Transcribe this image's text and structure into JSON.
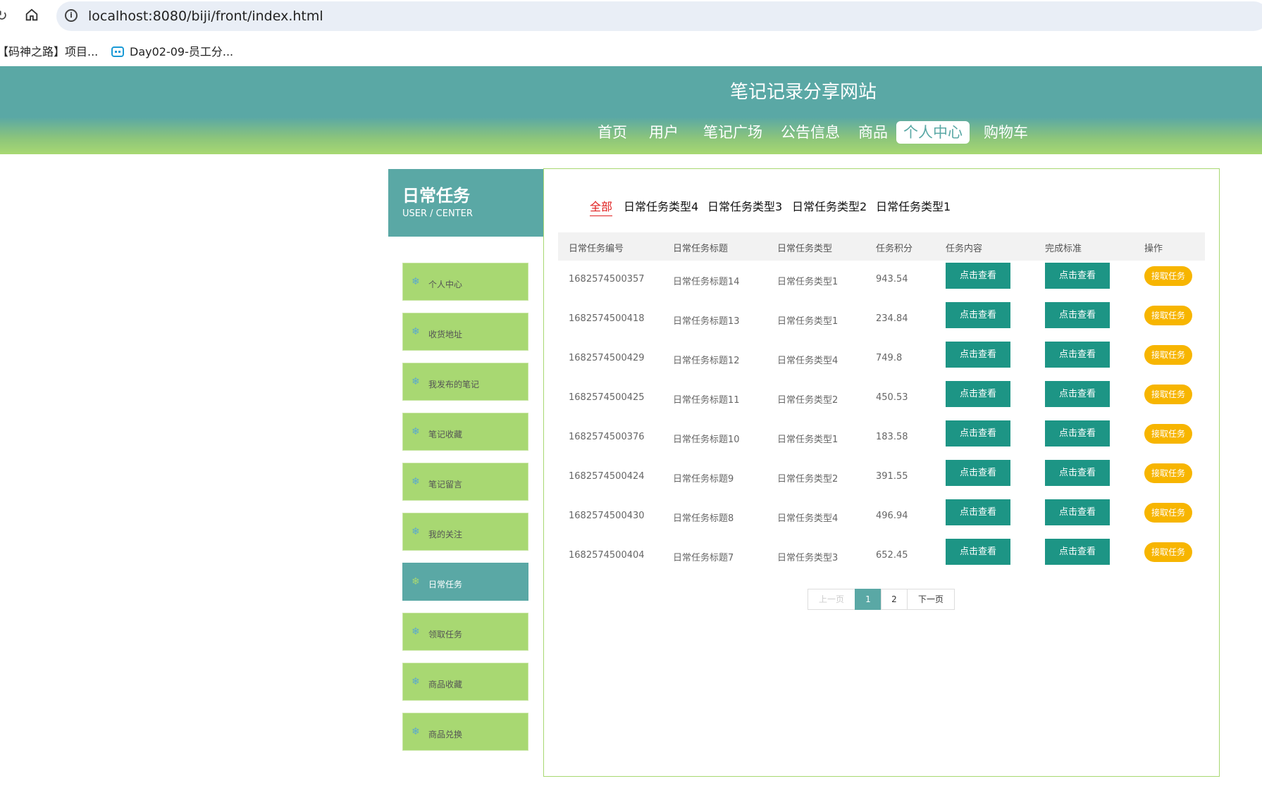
{
  "browser": {
    "url": "localhost:8080/biji/front/index.html",
    "bookmarks": [
      "【码神之路】项目...",
      "Day02-09-员工分..."
    ]
  },
  "site": {
    "title": "笔记记录分享网站",
    "nav": [
      "首页",
      "用户",
      "笔记广场",
      "公告信息",
      "商品",
      "个人中心",
      "购物车"
    ],
    "nav_active": "个人中心"
  },
  "sidebar": {
    "title": "日常任务",
    "subtitle": "USER / CENTER",
    "items": [
      "个人中心",
      "收货地址",
      "我发布的笔记",
      "笔记收藏",
      "笔记留言",
      "我的关注",
      "日常任务",
      "领取任务",
      "商品收藏",
      "商品兑换"
    ],
    "active": "日常任务"
  },
  "filters": [
    "全部",
    "日常任务类型4",
    "日常任务类型3",
    "日常任务类型2",
    "日常任务类型1"
  ],
  "table": {
    "headers": [
      "日常任务编号",
      "日常任务标题",
      "日常任务类型",
      "任务积分",
      "任务内容",
      "完成标准",
      "操作"
    ],
    "view_label": "点击查看",
    "action_label": "接取任务",
    "rows": [
      [
        "1682574500357",
        "日常任务标题14",
        "日常任务类型1",
        "943.54"
      ],
      [
        "1682574500418",
        "日常任务标题13",
        "日常任务类型1",
        "234.84"
      ],
      [
        "1682574500429",
        "日常任务标题12",
        "日常任务类型4",
        "749.8"
      ],
      [
        "1682574500425",
        "日常任务标题11",
        "日常任务类型2",
        "450.53"
      ],
      [
        "1682574500376",
        "日常任务标题10",
        "日常任务类型1",
        "183.58"
      ],
      [
        "1682574500424",
        "日常任务标题9",
        "日常任务类型2",
        "391.55"
      ],
      [
        "1682574500430",
        "日常任务标题8",
        "日常任务类型4",
        "496.94"
      ],
      [
        "1682574500404",
        "日常任务标题7",
        "日常任务类型3",
        "652.45"
      ]
    ]
  },
  "pager": {
    "prev": "上一页",
    "pages": [
      "1",
      "2"
    ],
    "current": "1",
    "next": "下一页"
  },
  "colors": {
    "primary": "#5aa8a5",
    "accent_green": "#a8d872",
    "button_teal": "#1d9585",
    "button_orange": "#f7b500",
    "filter_active": "#e02020"
  }
}
